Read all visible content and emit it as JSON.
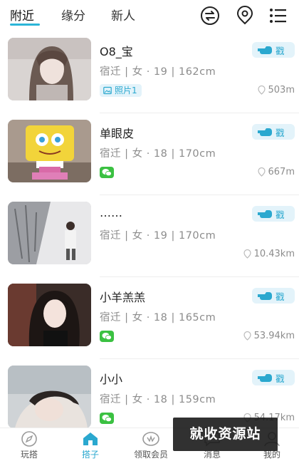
{
  "tabs": [
    {
      "label": "附近",
      "active": true
    },
    {
      "label": "缘分",
      "active": false
    },
    {
      "label": "新人",
      "active": false
    }
  ],
  "top_icons": [
    "swap-icon",
    "location-pin-icon",
    "list-menu-icon"
  ],
  "poke_label": "戳",
  "photos_label": "照片1",
  "users": [
    {
      "name": "O8_宝",
      "info": "宿迁 | 女 · 19 | 162cm",
      "tag": "photos",
      "distance": "503m"
    },
    {
      "name": "单眼皮",
      "info": "宿迁 | 女 · 18 | 170cm",
      "tag": "wechat",
      "distance": "667m"
    },
    {
      "name": "……",
      "info": "宿迁 | 女 · 19 | 170cm",
      "tag": "none",
      "distance": "10.43km"
    },
    {
      "name": "小羊羔羔",
      "info": "宿迁 | 女 · 18 | 165cm",
      "tag": "wechat",
      "distance": "53.94km"
    },
    {
      "name": "小小",
      "info": "宿迁 | 女 · 18 | 159cm",
      "tag": "wechat",
      "distance": "54.17km"
    }
  ],
  "bottom_nav": [
    {
      "label": "玩搭",
      "icon": "compass-icon",
      "active": false
    },
    {
      "label": "搭子",
      "icon": "home-icon",
      "active": true
    },
    {
      "label": "领取会员",
      "icon": "vip-icon",
      "active": false
    },
    {
      "label": "消息",
      "icon": "message-icon",
      "active": false
    },
    {
      "label": "我的",
      "icon": "profile-icon",
      "active": false
    }
  ],
  "watermark": "就收资源站",
  "colors": {
    "accent": "#2aa8cf",
    "poke_bg": "#e3f3fa",
    "wechat": "#3bc142",
    "muted": "#8c8c8c"
  }
}
